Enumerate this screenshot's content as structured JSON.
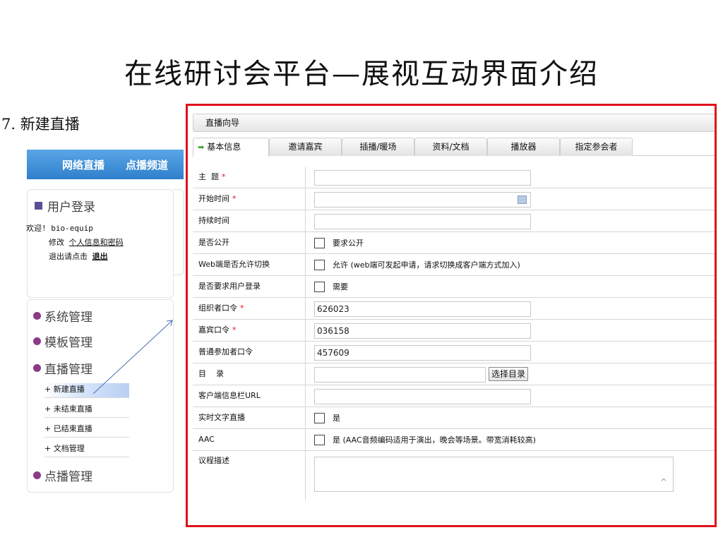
{
  "slide": {
    "title": "在线研讨会平台—展视互动界面介绍",
    "step": "7. 新建直播"
  },
  "sidebar": {
    "topnav": [
      "网络直播",
      "点播频道"
    ],
    "login": {
      "heading": "用户登录",
      "welcome": "欢迎! bio-equip",
      "modify_prefix": "修改",
      "modify_link": "个人信息和密码",
      "logout_prefix": "退出请点击",
      "logout_link": "退出"
    },
    "menu": {
      "system": "系统管理",
      "template": "模板管理",
      "live": "直播管理",
      "live_items": [
        "+ 新建直播",
        "+ 未结束直播",
        "+ 已结束直播",
        "+ 文档管理"
      ],
      "vod": "点播管理"
    }
  },
  "wizard": {
    "header": "直播向导",
    "tabs": [
      "基本信息",
      "邀请嘉宾",
      "插播/暖场",
      "资料/文档",
      "播放器",
      "指定参会者"
    ],
    "active_tab": "基本信息",
    "select_dir_button": "选择目录",
    "fields": {
      "subject": "主  题",
      "start_time": "开始时间",
      "duration": "持续时间",
      "public": "是否公开",
      "public_opt": "要求公开",
      "web_switch": "Web端是否允许切换",
      "web_switch_opt": "允许 (web端可发起申请，请求切换成客户端方式加入)",
      "login_required": "是否要求用户登录",
      "login_required_opt": "需要",
      "organizer_pwd": "组织者口令",
      "organizer_pwd_value": "626023",
      "guest_pwd": "嘉宾口令",
      "guest_pwd_value": "036158",
      "attendee_pwd": "普通参加者口令",
      "attendee_pwd_value": "457609",
      "directory": "目    录",
      "client_url": "客户端信息栏URL",
      "live_text": "实时文字直播",
      "live_text_opt": "是",
      "aac": "AAC",
      "aac_opt": "是  (AAC音频编码适用于演出，晚会等场景。带宽消耗较高)",
      "agenda": "议程描述"
    },
    "required_mark": "*"
  },
  "colors": {
    "frame_red": "#e0111a",
    "nav_blue": "#2f7fcc",
    "menu_dot": "#8a3a87"
  }
}
